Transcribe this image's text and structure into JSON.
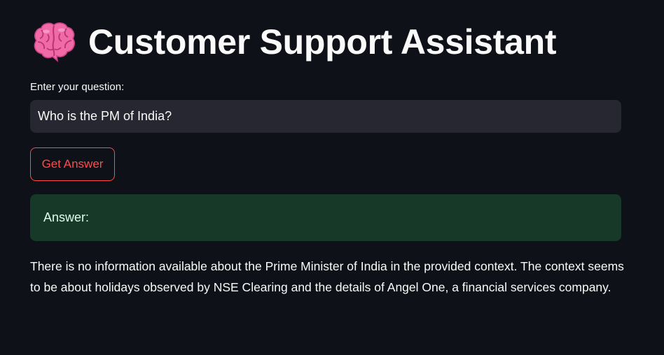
{
  "header": {
    "title": "Customer Support Assistant",
    "icon": "brain-icon"
  },
  "question": {
    "label": "Enter your question:",
    "value": "Who is the PM of India?"
  },
  "actions": {
    "get_answer_label": "Get Answer"
  },
  "answer": {
    "label": "Answer:",
    "text": "There is no information available about the Prime Minister of India in the provided context. The context seems to be about holidays observed by NSE Clearing and the details of Angel One, a financial services company."
  },
  "colors": {
    "background": "#0e1117",
    "input_bg": "#262730",
    "accent": "#ff4b4b",
    "success_bg": "#173928",
    "success_text": "#dffde9",
    "brain": "#f06aa8"
  }
}
